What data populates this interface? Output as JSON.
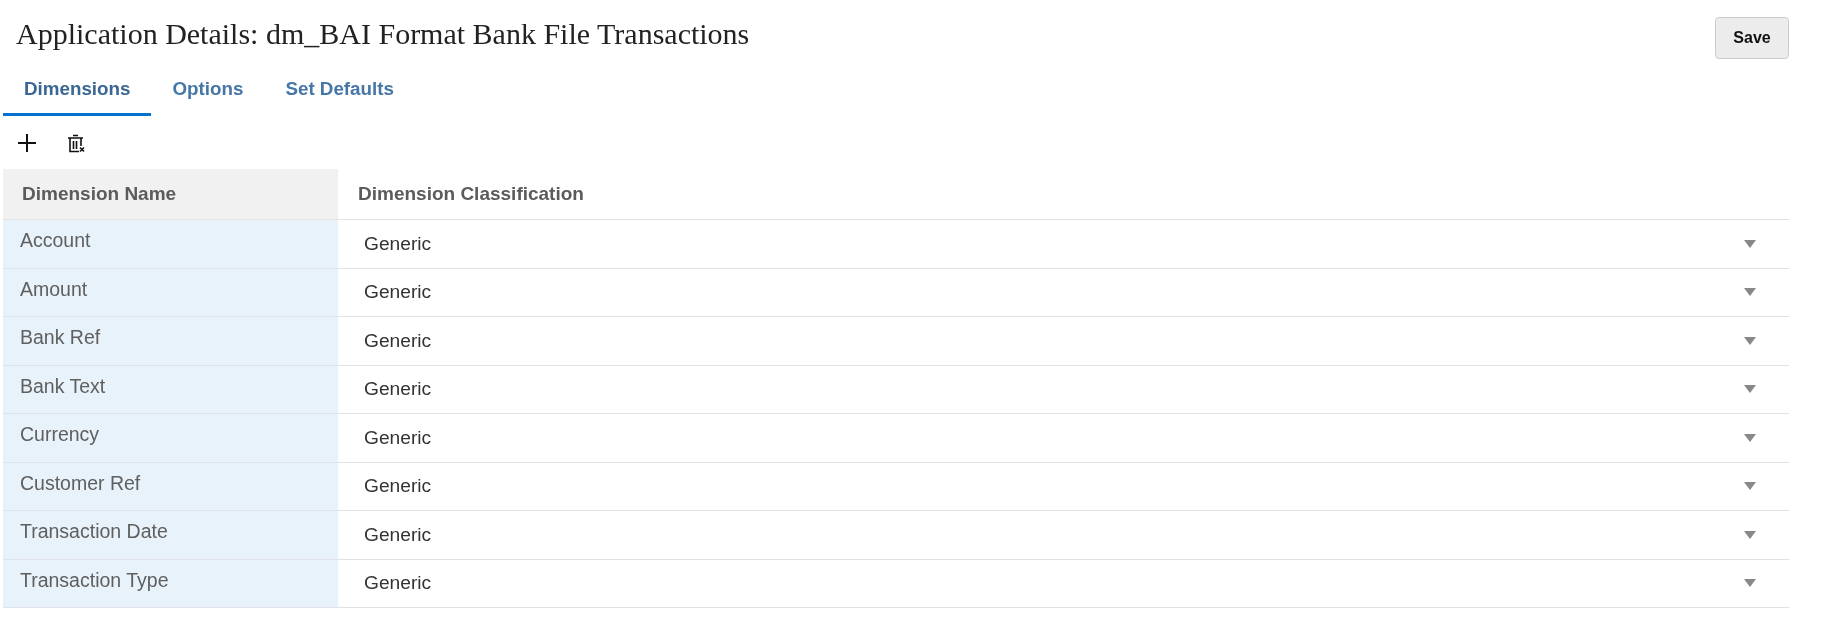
{
  "page": {
    "title": "Application Details: dm_BAI Format Bank File Transactions"
  },
  "save_button": {
    "label": "Save"
  },
  "tabs": [
    {
      "label": "Dimensions",
      "selected": true
    },
    {
      "label": "Options",
      "selected": false
    },
    {
      "label": "Set Defaults",
      "selected": false
    }
  ],
  "table": {
    "columns": [
      "Dimension Name",
      "Dimension Classification"
    ],
    "rows": [
      {
        "name": "Account",
        "classification": "Generic"
      },
      {
        "name": "Amount",
        "classification": "Generic"
      },
      {
        "name": "Bank Ref",
        "classification": "Generic"
      },
      {
        "name": "Bank Text",
        "classification": "Generic"
      },
      {
        "name": "Currency",
        "classification": "Generic"
      },
      {
        "name": "Customer Ref",
        "classification": "Generic"
      },
      {
        "name": "Transaction Date",
        "classification": "Generic"
      },
      {
        "name": "Transaction Type",
        "classification": "Generic"
      }
    ]
  }
}
